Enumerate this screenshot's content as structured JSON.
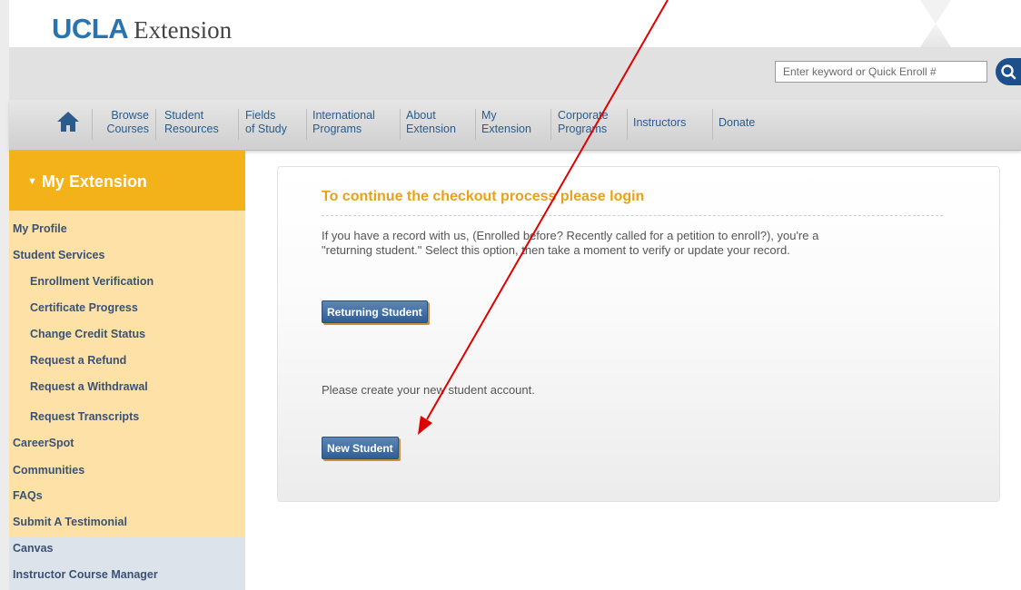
{
  "logo": {
    "ucla": "UCLA",
    "extension": "Extension"
  },
  "search": {
    "placeholder": "Enter keyword or Quick Enroll #"
  },
  "nav": {
    "items": [
      {
        "line1": "Browse",
        "line2": "Courses"
      },
      {
        "line1": "Student",
        "line2": "Resources"
      },
      {
        "line1": "Fields",
        "line2": "of Study"
      },
      {
        "line1": "International",
        "line2": "Programs"
      },
      {
        "line1": "About",
        "line2": "Extension"
      },
      {
        "line1": "My",
        "line2": "Extension"
      },
      {
        "line1": "Corporate",
        "line2": "Programs"
      },
      {
        "line1": "Instructors",
        "line2": ""
      },
      {
        "line1": "Donate",
        "line2": ""
      }
    ]
  },
  "sidebar": {
    "title": "My Extension",
    "items": [
      "My Profile",
      "Student Services",
      "Enrollment Verification",
      "Certificate Progress",
      "Change Credit Status",
      "Request a Refund",
      "Request a Withdrawal",
      "Request Transcripts",
      "CareerSpot",
      "Communities",
      "FAQs",
      "Submit A Testimonial",
      "Canvas",
      "Instructor Course Manager"
    ]
  },
  "main": {
    "title": "To continue the checkout process please login",
    "returning_text_line1": "If you have a record with us, (Enrolled before? Recently called for a petition to enroll?), you're a",
    "returning_text_line2": "\"returning student.\" Select this option, then take a moment to verify or update your record.",
    "returning_button": "Returning Student",
    "new_text": "Please create your new student account.",
    "new_button": "New Student"
  },
  "colors": {
    "ucla_blue": "#2774ae",
    "gold": "#f3b21a",
    "sidebar_bg": "#fde1a6",
    "link_blue": "#2b5b8c",
    "annotation_arrow": "#e00000"
  }
}
